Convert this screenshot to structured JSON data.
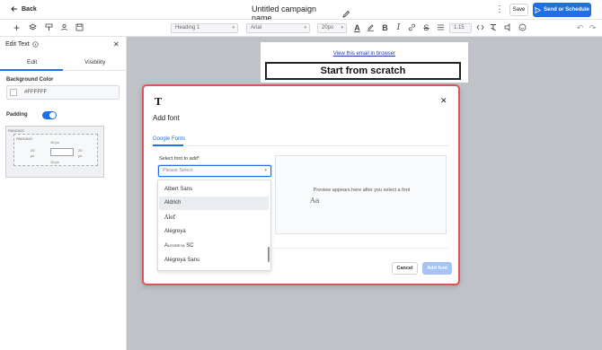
{
  "topbar": {
    "back_label": "Back",
    "title": "Untitled campaign name",
    "save_label": "Save",
    "send_label": "Send or Schedule"
  },
  "toolbar": {
    "heading_select": "Heading 1",
    "font_select": "Arial",
    "size_select": "20px",
    "line_height_select": "1.15",
    "icons_left": [
      "add-icon",
      "layers-icon",
      "paint-roller-icon",
      "people-icon",
      "save-template-icon"
    ],
    "icons_right": [
      "font-color-icon",
      "highlight-icon",
      "bold-icon",
      "italic-icon",
      "link-icon",
      "strikethrough-icon",
      "line-height-icon",
      "code-icon",
      "clear-format-icon",
      "undo-icon",
      "redo-icon"
    ]
  },
  "panel": {
    "title": "Edit Text",
    "tabs": [
      "Edit",
      "Visibility"
    ],
    "bg_label": "Background Color",
    "bg_value": "#FFFFFF",
    "padding_label": "Padding",
    "padding_enabled": true,
    "padding_box": {
      "header": "PADDING",
      "inner_header": "PADDING",
      "top": "10 px",
      "left": "20",
      "left_unit": "px",
      "right": "20",
      "right_unit": "px",
      "bottom": "10 px"
    }
  },
  "canvas": {
    "view_link": "View this email in browser",
    "scratch_title": "Start from scratch"
  },
  "modal": {
    "title": "Add font",
    "tab": "Google Fonts",
    "field_label": "Select font to add*",
    "select_placeholder": "Please Select",
    "options": [
      "Albert Sans",
      "Aldrich",
      "Alef",
      "Alegreya",
      "Alegreya SC",
      "Alegreya Sans"
    ],
    "selected_option": "Aldrich",
    "preview_text": "Preview appears here after you select a font",
    "preview_sample": "Aa",
    "cancel_label": "Cancel",
    "add_label": "Add font"
  }
}
